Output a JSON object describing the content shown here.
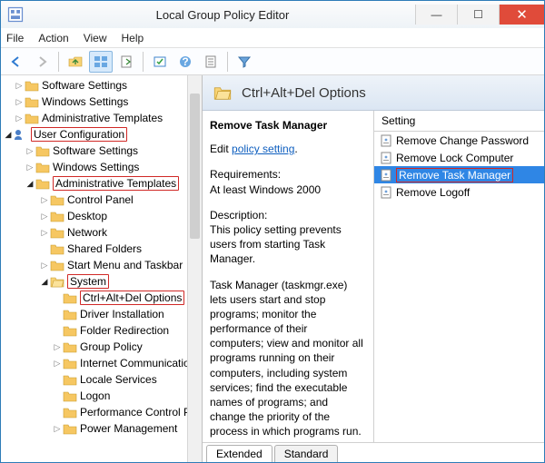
{
  "window": {
    "title": "Local Group Policy Editor"
  },
  "menu": {
    "file": "File",
    "action": "Action",
    "view": "View",
    "help": "Help"
  },
  "tree": {
    "n0": "Software Settings",
    "n1": "Windows Settings",
    "n2": "Administrative Templates",
    "n3": "User Configuration",
    "n4": "Software Settings",
    "n5": "Windows Settings",
    "n6": "Administrative Templates",
    "n7": "Control Panel",
    "n8": "Desktop",
    "n9": "Network",
    "n10": "Shared Folders",
    "n11": "Start Menu and Taskbar",
    "n12": "System",
    "n13": "Ctrl+Alt+Del Options",
    "n14": "Driver Installation",
    "n15": "Folder Redirection",
    "n16": "Group Policy",
    "n17": "Internet Communication",
    "n18": "Locale Services",
    "n19": "Logon",
    "n20": "Performance Control Pa",
    "n21": "Power Management"
  },
  "detail": {
    "header": "Ctrl+Alt+Del Options",
    "name": "Remove Task Manager",
    "edit_prefix": "Edit",
    "edit_link": "policy setting",
    "req_label": "Requirements:",
    "req_value": "At least Windows 2000",
    "desc_label": "Description:",
    "desc1": "This policy setting prevents users from starting Task Manager.",
    "desc2": "Task Manager (taskmgr.exe) lets users start and stop programs; monitor the performance of their computers; view and monitor all programs running on their computers, including system services; find the executable names of programs; and change the priority of the process in which programs run."
  },
  "settings": {
    "col": "Setting",
    "s0": "Remove Change Password",
    "s1": "Remove Lock Computer",
    "s2": "Remove Task Manager",
    "s3": "Remove Logoff"
  },
  "tabs": {
    "extended": "Extended",
    "standard": "Standard"
  }
}
